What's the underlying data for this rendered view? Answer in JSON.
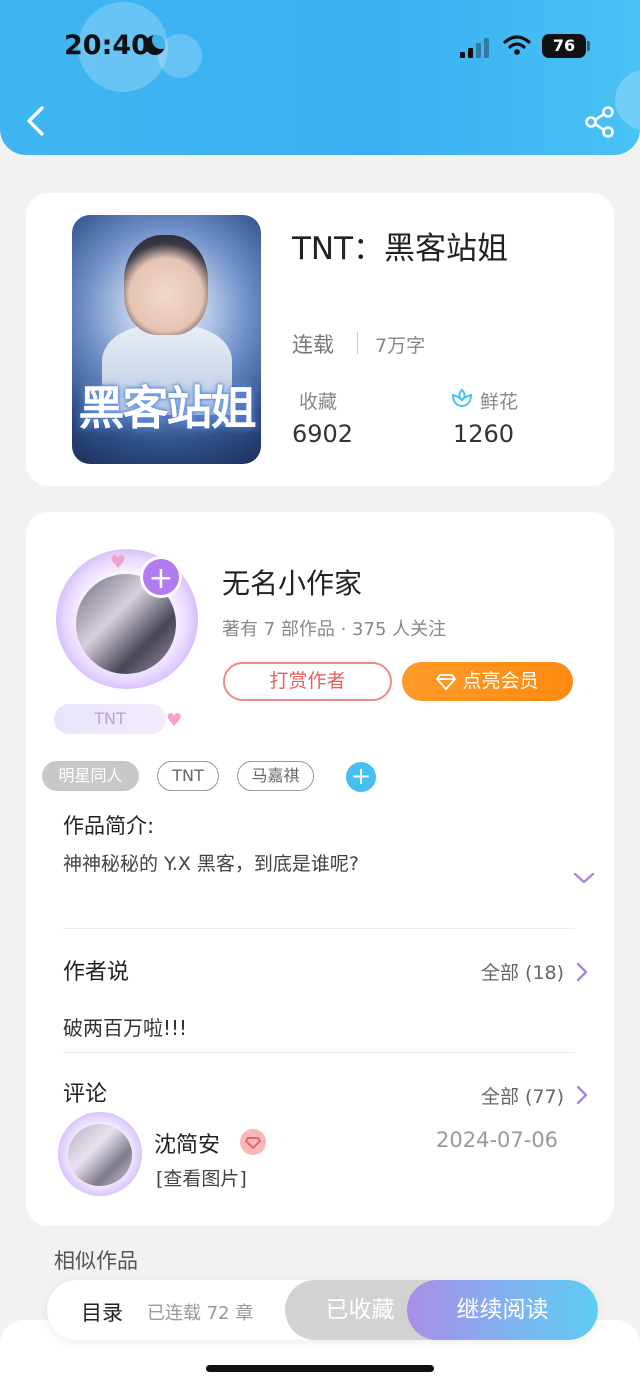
{
  "status_bar": {
    "time": "20:40",
    "battery": "76"
  },
  "header": {
    "back_icon": "chevron-left-icon",
    "share_icon": "share-icon"
  },
  "book": {
    "title": "TNT：黑客站姐",
    "cover_text": "黑客站姐",
    "status": "连载",
    "word_count": "7万字",
    "favorites_label": "收藏",
    "favorites_value": "6902",
    "flowers_label": "鲜花",
    "flowers_value": "1260"
  },
  "author": {
    "name": "无名小作家",
    "stats": "著有 7 部作品 · 375 人关注",
    "avatar_tag": "TNT",
    "tip_button": "打赏作者",
    "vip_button": "点亮会员"
  },
  "tags": [
    "明星同人",
    "TNT",
    "马嘉祺"
  ],
  "intro": {
    "title": "作品简介:",
    "text": "神神秘秘的 Y.X 黑客，到底是谁呢?"
  },
  "author_say": {
    "title": "作者说",
    "all_link": "全部 (18)",
    "text": "破两百万啦!!!"
  },
  "comments": {
    "title": "评论",
    "all_link": "全部 (77)",
    "items": [
      {
        "user": "沈简安",
        "date": "2024-07-06",
        "text": "[查看图片]"
      }
    ]
  },
  "similar": {
    "title": "相似作品"
  },
  "bottom_bar": {
    "toc_label": "目录",
    "chapters": "已连载 72 章",
    "favorited_button": "已收藏",
    "read_button": "继续阅读"
  },
  "colors": {
    "header_blue": "#3fb6f0",
    "vip_orange": "#ff8a10",
    "tip_red": "#e66060",
    "accent_purple": "#b07cf0"
  }
}
